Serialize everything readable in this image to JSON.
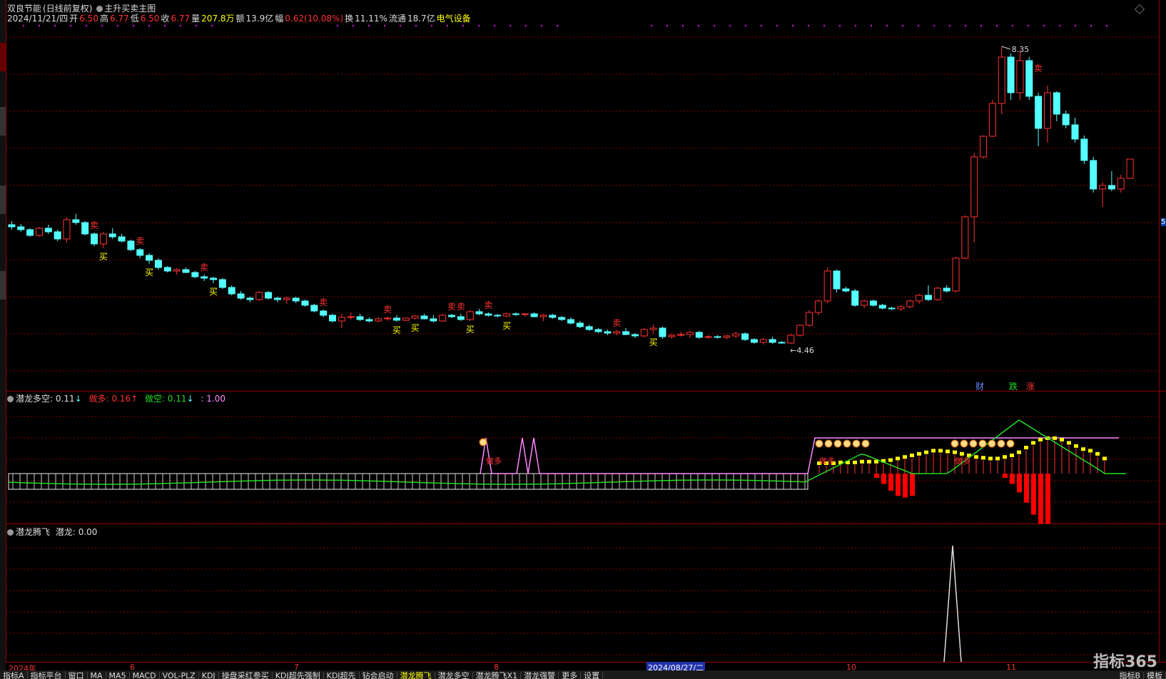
{
  "header": {
    "stock_name": "双良节能",
    "price_mode": "(日线前复权)",
    "indicator_name": "主升买卖主图",
    "date": "2024/11/21/四",
    "open_label": "开",
    "open": "6.50",
    "high_label": "高",
    "high": "6.77",
    "low_label": "低",
    "low": "6.50",
    "close_label": "收",
    "close": "6.77",
    "vol_label": "量",
    "vol": "207.8万",
    "amount_label": "额",
    "amount": "13.9亿",
    "chg_label": "幅",
    "chg": "0.62(10.08%)",
    "turnover_label": "换",
    "turnover": "11.11%",
    "float_label": "流通",
    "float": "18.7亿",
    "sector": "电气设备"
  },
  "panel2": {
    "title": "潜龙多空",
    "v1": ": 0.11",
    "long_label": "做多: 0.16",
    "short_label": "做空: 0.11",
    "v4": ": 1.00"
  },
  "panel3": {
    "title": "潜龙腾飞",
    "label": "潜龙: 0.00"
  },
  "annotations": {
    "high_value": "8.35",
    "low_value": "4.46",
    "buy": "买",
    "sell": "卖",
    "long": "做多",
    "fin": "财",
    "fall": "跌",
    "rise": "涨",
    "right_price": "5."
  },
  "axis": {
    "year": "2024年",
    "m6": "6",
    "m7": "7",
    "m8": "8",
    "m10": "10",
    "m11": "11",
    "cursor_date": "2024/08/27/二"
  },
  "tabs": [
    "指标A",
    "指标平台",
    "窗口",
    "MA",
    "MA5",
    "MACD",
    "VOL-PLZ",
    "KDJ",
    "操盘采红参买",
    "KDJ超先强制",
    "KDJ超先",
    "钻会启动",
    "潜龙腾飞",
    "潜龙多空",
    "潜龙腾飞X1",
    "潜龙强警",
    "更多",
    "设置"
  ],
  "tabs_right": [
    "指标B",
    "模板"
  ],
  "watermark": "指标365",
  "colors": {
    "up": "#ff3232",
    "down": "#54ffff",
    "grid": "#8a0000",
    "ma": "#22dd22",
    "pink": "#ff88ff"
  },
  "chart_data": [
    {
      "type": "candlestick",
      "title": "主升买卖主图",
      "ohlc": [
        [
          5.85,
          5.9,
          5.78,
          5.82
        ],
        [
          5.82,
          5.86,
          5.75,
          5.78
        ],
        [
          5.78,
          5.8,
          5.68,
          5.7
        ],
        [
          5.7,
          5.82,
          5.68,
          5.8
        ],
        [
          5.8,
          5.85,
          5.72,
          5.75
        ],
        [
          5.75,
          5.78,
          5.62,
          5.65
        ],
        [
          5.65,
          5.95,
          5.6,
          5.92
        ],
        [
          5.92,
          6.0,
          5.85,
          5.88
        ],
        [
          5.88,
          5.9,
          5.7,
          5.72
        ],
        [
          5.72,
          5.74,
          5.55,
          5.58
        ],
        [
          5.58,
          5.75,
          5.52,
          5.72
        ],
        [
          5.72,
          5.8,
          5.65,
          5.68
        ],
        [
          5.68,
          5.72,
          5.6,
          5.62
        ],
        [
          5.62,
          5.64,
          5.48,
          5.5
        ],
        [
          5.5,
          5.52,
          5.38,
          5.42
        ],
        [
          5.42,
          5.45,
          5.3,
          5.35
        ],
        [
          5.35,
          5.38,
          5.22,
          5.25
        ],
        [
          5.25,
          5.27,
          5.18,
          5.2
        ],
        [
          5.2,
          5.24,
          5.15,
          5.22
        ],
        [
          5.22,
          5.25,
          5.17,
          5.18
        ],
        [
          5.18,
          5.2,
          5.1,
          5.12
        ],
        [
          5.12,
          5.15,
          5.06,
          5.1
        ],
        [
          5.1,
          5.12,
          5.03,
          5.08
        ],
        [
          5.08,
          5.1,
          4.95,
          4.97
        ],
        [
          4.97,
          5.0,
          4.86,
          4.88
        ],
        [
          4.88,
          4.92,
          4.8,
          4.82
        ],
        [
          4.82,
          4.84,
          4.76,
          4.8
        ],
        [
          4.8,
          4.92,
          4.78,
          4.9
        ],
        [
          4.9,
          4.92,
          4.8,
          4.82
        ],
        [
          4.82,
          4.84,
          4.76,
          4.8
        ],
        [
          4.8,
          4.84,
          4.74,
          4.82
        ],
        [
          4.82,
          4.84,
          4.75,
          4.78
        ],
        [
          4.78,
          4.8,
          4.7,
          4.72
        ],
        [
          4.72,
          4.74,
          4.62,
          4.64
        ],
        [
          4.64,
          4.66,
          4.55,
          4.58
        ],
        [
          4.58,
          4.6,
          4.48,
          4.5
        ],
        [
          4.5,
          4.6,
          4.4,
          4.55
        ],
        [
          4.55,
          4.62,
          4.52,
          4.56
        ],
        [
          4.56,
          4.6,
          4.5,
          4.52
        ],
        [
          4.52,
          4.55,
          4.48,
          4.5
        ],
        [
          4.5,
          4.55,
          4.48,
          4.53
        ],
        [
          4.53,
          4.56,
          4.5,
          4.54
        ],
        [
          4.54,
          4.58,
          4.49,
          4.51
        ],
        [
          4.51,
          4.55,
          4.5,
          4.54
        ],
        [
          4.54,
          4.58,
          4.52,
          4.57
        ],
        [
          4.57,
          4.6,
          4.52,
          4.53
        ],
        [
          4.53,
          4.58,
          4.48,
          4.5
        ],
        [
          4.5,
          4.6,
          4.49,
          4.58
        ],
        [
          4.58,
          4.6,
          4.54,
          4.56
        ],
        [
          4.56,
          4.6,
          4.5,
          4.52
        ],
        [
          4.52,
          4.65,
          4.5,
          4.63
        ],
        [
          4.63,
          4.67,
          4.58,
          4.6
        ],
        [
          4.6,
          4.62,
          4.56,
          4.58
        ],
        [
          4.58,
          4.6,
          4.55,
          4.57
        ],
        [
          4.57,
          4.62,
          4.55,
          4.6
        ],
        [
          4.6,
          4.62,
          4.57,
          4.59
        ],
        [
          4.59,
          4.61,
          4.56,
          4.6
        ],
        [
          4.6,
          4.62,
          4.55,
          4.56
        ],
        [
          4.56,
          4.6,
          4.5,
          4.58
        ],
        [
          4.58,
          4.6,
          4.53,
          4.55
        ],
        [
          4.55,
          4.57,
          4.5,
          4.52
        ],
        [
          4.52,
          4.55,
          4.45,
          4.47
        ],
        [
          4.47,
          4.5,
          4.4,
          4.42
        ],
        [
          4.42,
          4.45,
          4.36,
          4.38
        ],
        [
          4.38,
          4.4,
          4.33,
          4.35
        ],
        [
          4.35,
          4.38,
          4.3,
          4.33
        ],
        [
          4.33,
          4.37,
          4.3,
          4.35
        ],
        [
          4.35,
          4.4,
          4.3,
          4.31
        ],
        [
          4.31,
          4.33,
          4.26,
          4.29
        ],
        [
          4.29,
          4.4,
          4.27,
          4.38
        ],
        [
          4.38,
          4.45,
          4.32,
          4.4
        ],
        [
          4.4,
          4.42,
          4.25,
          4.28
        ],
        [
          4.28,
          4.32,
          4.25,
          4.3
        ],
        [
          4.3,
          4.35,
          4.28,
          4.31
        ],
        [
          4.31,
          4.36,
          4.26,
          4.34
        ],
        [
          4.34,
          4.36,
          4.25,
          4.27
        ],
        [
          4.27,
          4.3,
          4.25,
          4.28
        ],
        [
          4.28,
          4.3,
          4.25,
          4.27
        ],
        [
          4.27,
          4.3,
          4.24,
          4.29
        ],
        [
          4.29,
          4.35,
          4.26,
          4.32
        ],
        [
          4.32,
          4.34,
          4.22,
          4.24
        ],
        [
          4.24,
          4.26,
          4.18,
          4.2
        ],
        [
          4.2,
          4.26,
          4.17,
          4.24
        ],
        [
          4.24,
          4.28,
          4.18,
          4.2
        ],
        [
          4.2,
          4.22,
          4.18,
          4.19
        ],
        [
          4.19,
          4.32,
          4.18,
          4.3
        ],
        [
          4.3,
          4.45,
          4.28,
          4.44
        ],
        [
          4.44,
          4.65,
          4.42,
          4.62
        ],
        [
          4.62,
          4.8,
          4.58,
          4.78
        ],
        [
          4.78,
          5.25,
          4.75,
          5.2
        ],
        [
          5.2,
          5.22,
          4.9,
          4.95
        ],
        [
          4.95,
          4.98,
          4.9,
          4.92
        ],
        [
          4.92,
          4.95,
          4.7,
          4.72
        ],
        [
          4.72,
          4.8,
          4.68,
          4.78
        ],
        [
          4.78,
          4.8,
          4.7,
          4.72
        ],
        [
          4.72,
          4.74,
          4.66,
          4.68
        ],
        [
          4.68,
          4.7,
          4.65,
          4.67
        ],
        [
          4.67,
          4.72,
          4.64,
          4.7
        ],
        [
          4.7,
          4.8,
          4.68,
          4.78
        ],
        [
          4.78,
          4.88,
          4.74,
          4.86
        ],
        [
          4.86,
          5.0,
          4.78,
          4.8
        ],
        [
          4.8,
          4.98,
          4.78,
          4.96
        ],
        [
          4.96,
          5.0,
          4.9,
          4.92
        ],
        [
          4.92,
          5.4,
          4.9,
          5.38
        ],
        [
          5.38,
          5.98,
          5.37,
          5.96
        ],
        [
          5.96,
          6.85,
          5.6,
          6.8
        ],
        [
          6.8,
          7.1,
          6.78,
          7.09
        ],
        [
          7.09,
          7.6,
          7.08,
          7.55
        ],
        [
          7.55,
          8.35,
          7.4,
          8.2
        ],
        [
          8.2,
          8.25,
          7.6,
          7.7
        ],
        [
          7.7,
          8.3,
          7.6,
          8.15
        ],
        [
          8.15,
          8.2,
          7.6,
          7.65
        ],
        [
          7.65,
          7.7,
          6.95,
          7.2
        ],
        [
          7.2,
          7.8,
          7.0,
          7.7
        ],
        [
          7.7,
          7.72,
          7.3,
          7.4
        ],
        [
          7.4,
          7.45,
          7.2,
          7.25
        ],
        [
          7.25,
          7.35,
          7.0,
          7.05
        ],
        [
          7.05,
          7.1,
          6.7,
          6.75
        ],
        [
          6.75,
          6.8,
          6.3,
          6.35
        ],
        [
          6.35,
          6.45,
          6.1,
          6.4
        ],
        [
          6.4,
          6.6,
          6.32,
          6.35
        ],
        [
          6.35,
          6.55,
          6.3,
          6.5
        ],
        [
          6.5,
          6.77,
          6.5,
          6.77
        ]
      ],
      "max_label": "8.35",
      "min_label": "4.46"
    },
    {
      "type": "histogram",
      "title": "潜龙多空",
      "series": [
        {
          "name": "做多",
          "values": [
            0.1,
            0.1,
            0.1,
            0.11,
            0.11,
            0.11,
            0.12,
            0.12,
            0.12,
            0.13,
            0.14,
            0.16,
            0.18,
            0.2,
            0.22,
            0.24,
            0.26,
            0.26,
            0.25,
            0.24,
            0.22,
            0.2,
            0.18,
            0.17,
            0.16,
            0.16,
            0.18,
            0.2,
            0.24,
            0.3,
            0.36,
            0.4,
            0.42,
            0.42,
            0.4,
            0.36,
            0.32,
            0.28,
            0.26,
            0.22,
            0.16
          ]
        },
        {
          "name": "做空",
          "values": [
            0.0,
            0.0,
            0.0,
            0.0,
            0.0,
            0.0,
            0.0,
            0.0,
            0.05,
            0.12,
            0.2,
            0.26,
            0.28,
            0.26,
            0.0,
            0.0,
            0.0,
            0.0,
            0.0,
            0.0,
            0.0,
            0.0,
            0.0,
            0.0,
            0.0,
            0.0,
            0.05,
            0.12,
            0.22,
            0.34,
            0.48,
            0.6,
            0.72,
            0.0,
            0.0,
            0.0,
            0.0,
            0.0,
            0.0,
            0.0,
            0.0
          ]
        }
      ],
      "v1": 0.11,
      "long": 0.16,
      "short": 0.11,
      "ref": 1.0
    },
    {
      "type": "line",
      "title": "潜龙腾飞",
      "series": [
        {
          "name": "潜龙",
          "values": [
            0,
            0,
            0,
            0,
            0,
            0,
            0,
            0,
            0,
            0,
            0,
            0,
            0,
            0,
            0,
            0,
            0,
            0,
            0,
            0,
            1,
            0,
            0,
            0,
            0,
            0,
            0,
            0,
            0
          ]
        }
      ],
      "value": 0.0
    }
  ]
}
